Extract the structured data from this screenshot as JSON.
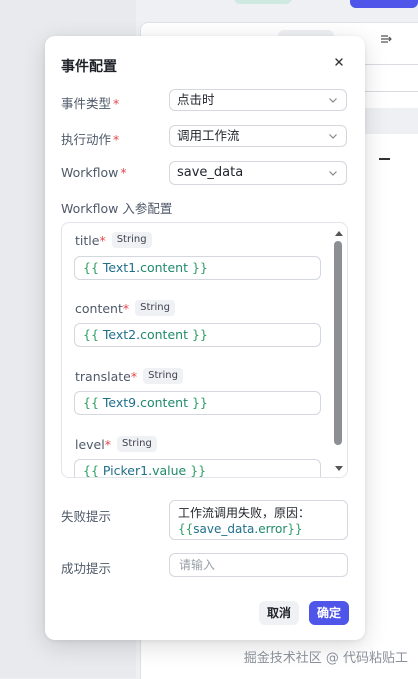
{
  "modal": {
    "title": "事件配置",
    "event_type": {
      "label": "事件类型",
      "value": "点击时"
    },
    "action": {
      "label": "执行动作",
      "value": "调用工作流"
    },
    "workflow": {
      "label": "Workflow",
      "value": "save_data"
    },
    "params_label": "Workflow 入参配置",
    "params": [
      {
        "name": "title",
        "type": "String",
        "open": "{{",
        "var": "Text1",
        "dot": ".",
        "prop": "content",
        "close": "}}"
      },
      {
        "name": "content",
        "type": "String",
        "open": "{{",
        "var": "Text2",
        "dot": ".",
        "prop": "content",
        "close": "}}"
      },
      {
        "name": "translate",
        "type": "String",
        "open": "{{",
        "var": "Text9",
        "dot": ".",
        "prop": "content",
        "close": "}}"
      },
      {
        "name": "level",
        "type": "String",
        "open": "{{",
        "var": "Picker1",
        "dot": ".",
        "prop": "value",
        "close": "}}"
      }
    ],
    "fail": {
      "label": "失败提示",
      "line1": "工作流调用失败，原因：",
      "line2_open": "{{",
      "line2_var": "save_data",
      "line2_dot": ".",
      "line2_prop": "error",
      "line2_close": "}}"
    },
    "success": {
      "label": "成功提示",
      "placeholder": "请输入"
    },
    "cancel_label": "取消",
    "ok_label": "确定",
    "required_mark": "*"
  },
  "watermark": "掘金技术社区 @ 代码粘贴工",
  "colors": {
    "primary": "#4e55e8",
    "required": "#e5484d",
    "token": "#2e9f62"
  }
}
